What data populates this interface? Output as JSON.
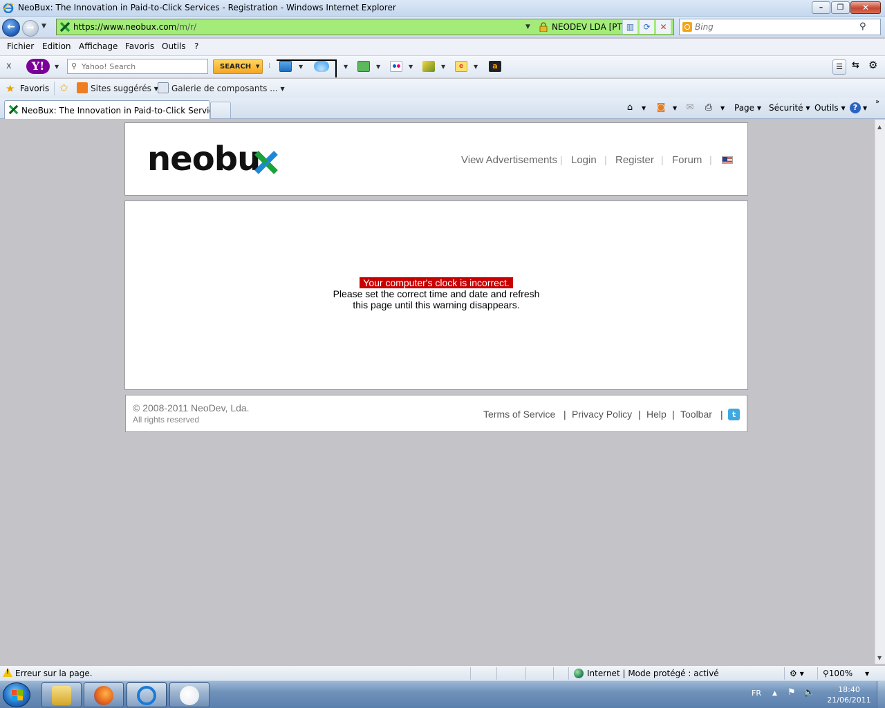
{
  "window": {
    "title": "NeoBux: The Innovation in Paid-to-Click Services - Registration - Windows Internet Explorer",
    "min_glyph": "–",
    "max_glyph": "❐",
    "close_glyph": "✕"
  },
  "address": {
    "url_host": "https://www.neobux.com",
    "url_path": "/m/r/",
    "cert_name": "NEODEV LDA [PT]",
    "search_placeholder": "Bing"
  },
  "menu": [
    "Fichier",
    "Edition",
    "Affichage",
    "Favoris",
    "Outils",
    "?"
  ],
  "yahoo_toolbar": {
    "close_glyph": "x",
    "logo": "Y!",
    "search_placeholder": "Yahoo! Search",
    "search_button": "SEARCH"
  },
  "favorites_bar": {
    "favorites_label": "Favoris",
    "items": [
      "Sites suggérés",
      "Galerie de composants ..."
    ]
  },
  "tabs": {
    "active_label": "NeoBux: The Innovation in Paid-to-Click Services...",
    "commands": [
      "Page",
      "Sécurité",
      "Outils"
    ]
  },
  "page": {
    "logo_text": "neobu",
    "nav": [
      "View Advertisements",
      "Login",
      "Register",
      "Forum"
    ],
    "nav_sep": "|",
    "alert": "Your computer's clock is incorrect.",
    "message_line1": "Please set the correct time and date and refresh",
    "message_line2": "this page until this warning disappears.",
    "copyright": "© 2008-2011 NeoDev, Lda.",
    "rights": "All rights reserved",
    "footer_links": [
      "Terms of Service",
      "Privacy Policy",
      "Help",
      "Toolbar"
    ],
    "twitter_glyph": "t"
  },
  "statusbar": {
    "error_text": "Erreur sur la page.",
    "zone_text": "Internet | Mode protégé : activé",
    "zoom": "100%"
  },
  "taskbar": {
    "language": "FR",
    "time": "18:40",
    "date": "21/06/2011"
  },
  "colors": {
    "alert_bg": "#c80000",
    "url_bar": "#a3ec7a",
    "logo_x_green": "#1aa33b",
    "logo_x_blue": "#1e88d6"
  }
}
